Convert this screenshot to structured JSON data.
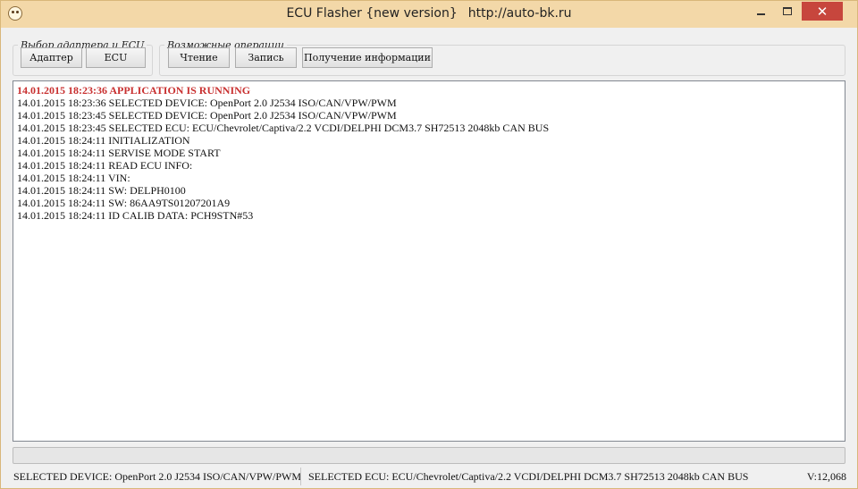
{
  "window": {
    "title": "ECU Flasher {new version}",
    "url": "http://auto-bk.ru",
    "close_glyph": "✕"
  },
  "groups": {
    "adapter": {
      "legend": "Выбор адаптера и ECU",
      "adapter_label": "Адаптер",
      "ecu_label": "ECU"
    },
    "operations": {
      "legend": "Возможные операции",
      "read_label": "Чтение",
      "write_label": "Запись",
      "info_label": "Получение информации"
    }
  },
  "log": {
    "lines": [
      "14.01.2015 18:23:36 APPLICATION IS RUNNING",
      "14.01.2015 18:23:36 SELECTED DEVICE: OpenPort 2.0 J2534 ISO/CAN/VPW/PWM",
      "14.01.2015 18:23:45 SELECTED DEVICE: OpenPort 2.0 J2534 ISO/CAN/VPW/PWM",
      "14.01.2015 18:23:45 SELECTED ECU: ECU/Chevrolet/Captiva/2.2 VCDI/DELPHI DCM3.7 SH72513 2048kb CAN BUS",
      "14.01.2015 18:24:11 INITIALIZATION",
      "14.01.2015 18:24:11 SERVISE MODE START",
      "14.01.2015 18:24:11 READ ECU INFO:",
      "14.01.2015 18:24:11 VIN:",
      "14.01.2015 18:24:11 SW: DELPH0100",
      "14.01.2015 18:24:11 SW: 86AA9TS01207201A9",
      "14.01.2015 18:24:11 ID CALIB DATA: PCH9STN#53"
    ],
    "head_color": "#c83030"
  },
  "progress": {
    "value": 0
  },
  "status": {
    "device": "SELECTED DEVICE: OpenPort 2.0 J2534 ISO/CAN/VPW/PWM",
    "ecu": "SELECTED ECU: ECU/Chevrolet/Captiva/2.2 VCDI/DELPHI DCM3.7 SH72513 2048kb CAN BUS",
    "version": "V:12,068"
  }
}
